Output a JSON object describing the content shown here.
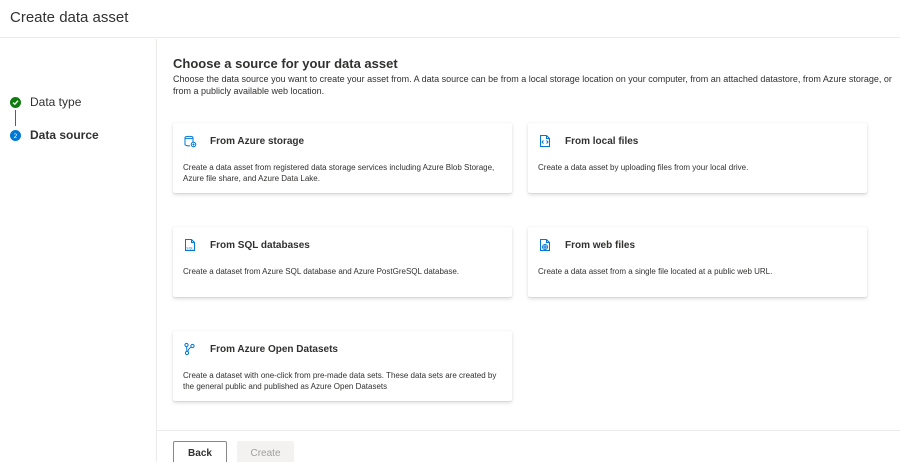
{
  "header": {
    "title": "Create data asset"
  },
  "stepper": {
    "steps": [
      {
        "label": "Data type",
        "status": "completed"
      },
      {
        "label": "Data source",
        "status": "current"
      }
    ]
  },
  "main": {
    "title": "Choose a source for your data asset",
    "description": "Choose the data source you want to create your asset from. A data source can be from a local storage location on your computer, from an attached datastore, from Azure storage, or from a publicly available web location."
  },
  "cards": [
    {
      "icon": "storage-icon",
      "title": "From Azure storage",
      "description": "Create a data asset from registered data storage services including Azure Blob Storage, Azure file share, and Azure Data Lake."
    },
    {
      "icon": "local-file-icon",
      "title": "From local files",
      "description": "Create a data asset by uploading files from your local drive."
    },
    {
      "icon": "sql-file-icon",
      "title": "From SQL databases",
      "description": "Create a dataset from Azure SQL database and Azure PostGreSQL database."
    },
    {
      "icon": "web-file-icon",
      "title": "From web files",
      "description": "Create a data asset from a single file located at a public web URL."
    },
    {
      "icon": "open-datasets-icon",
      "title": "From Azure Open Datasets",
      "description": "Create a dataset with one-click from pre-made data sets. These data sets are created by the general public and published as Azure Open Datasets"
    }
  ],
  "footer": {
    "back_label": "Back",
    "create_label": "Create"
  },
  "colors": {
    "accent": "#0078d4",
    "success": "#107c10",
    "border": "#edebe9"
  }
}
